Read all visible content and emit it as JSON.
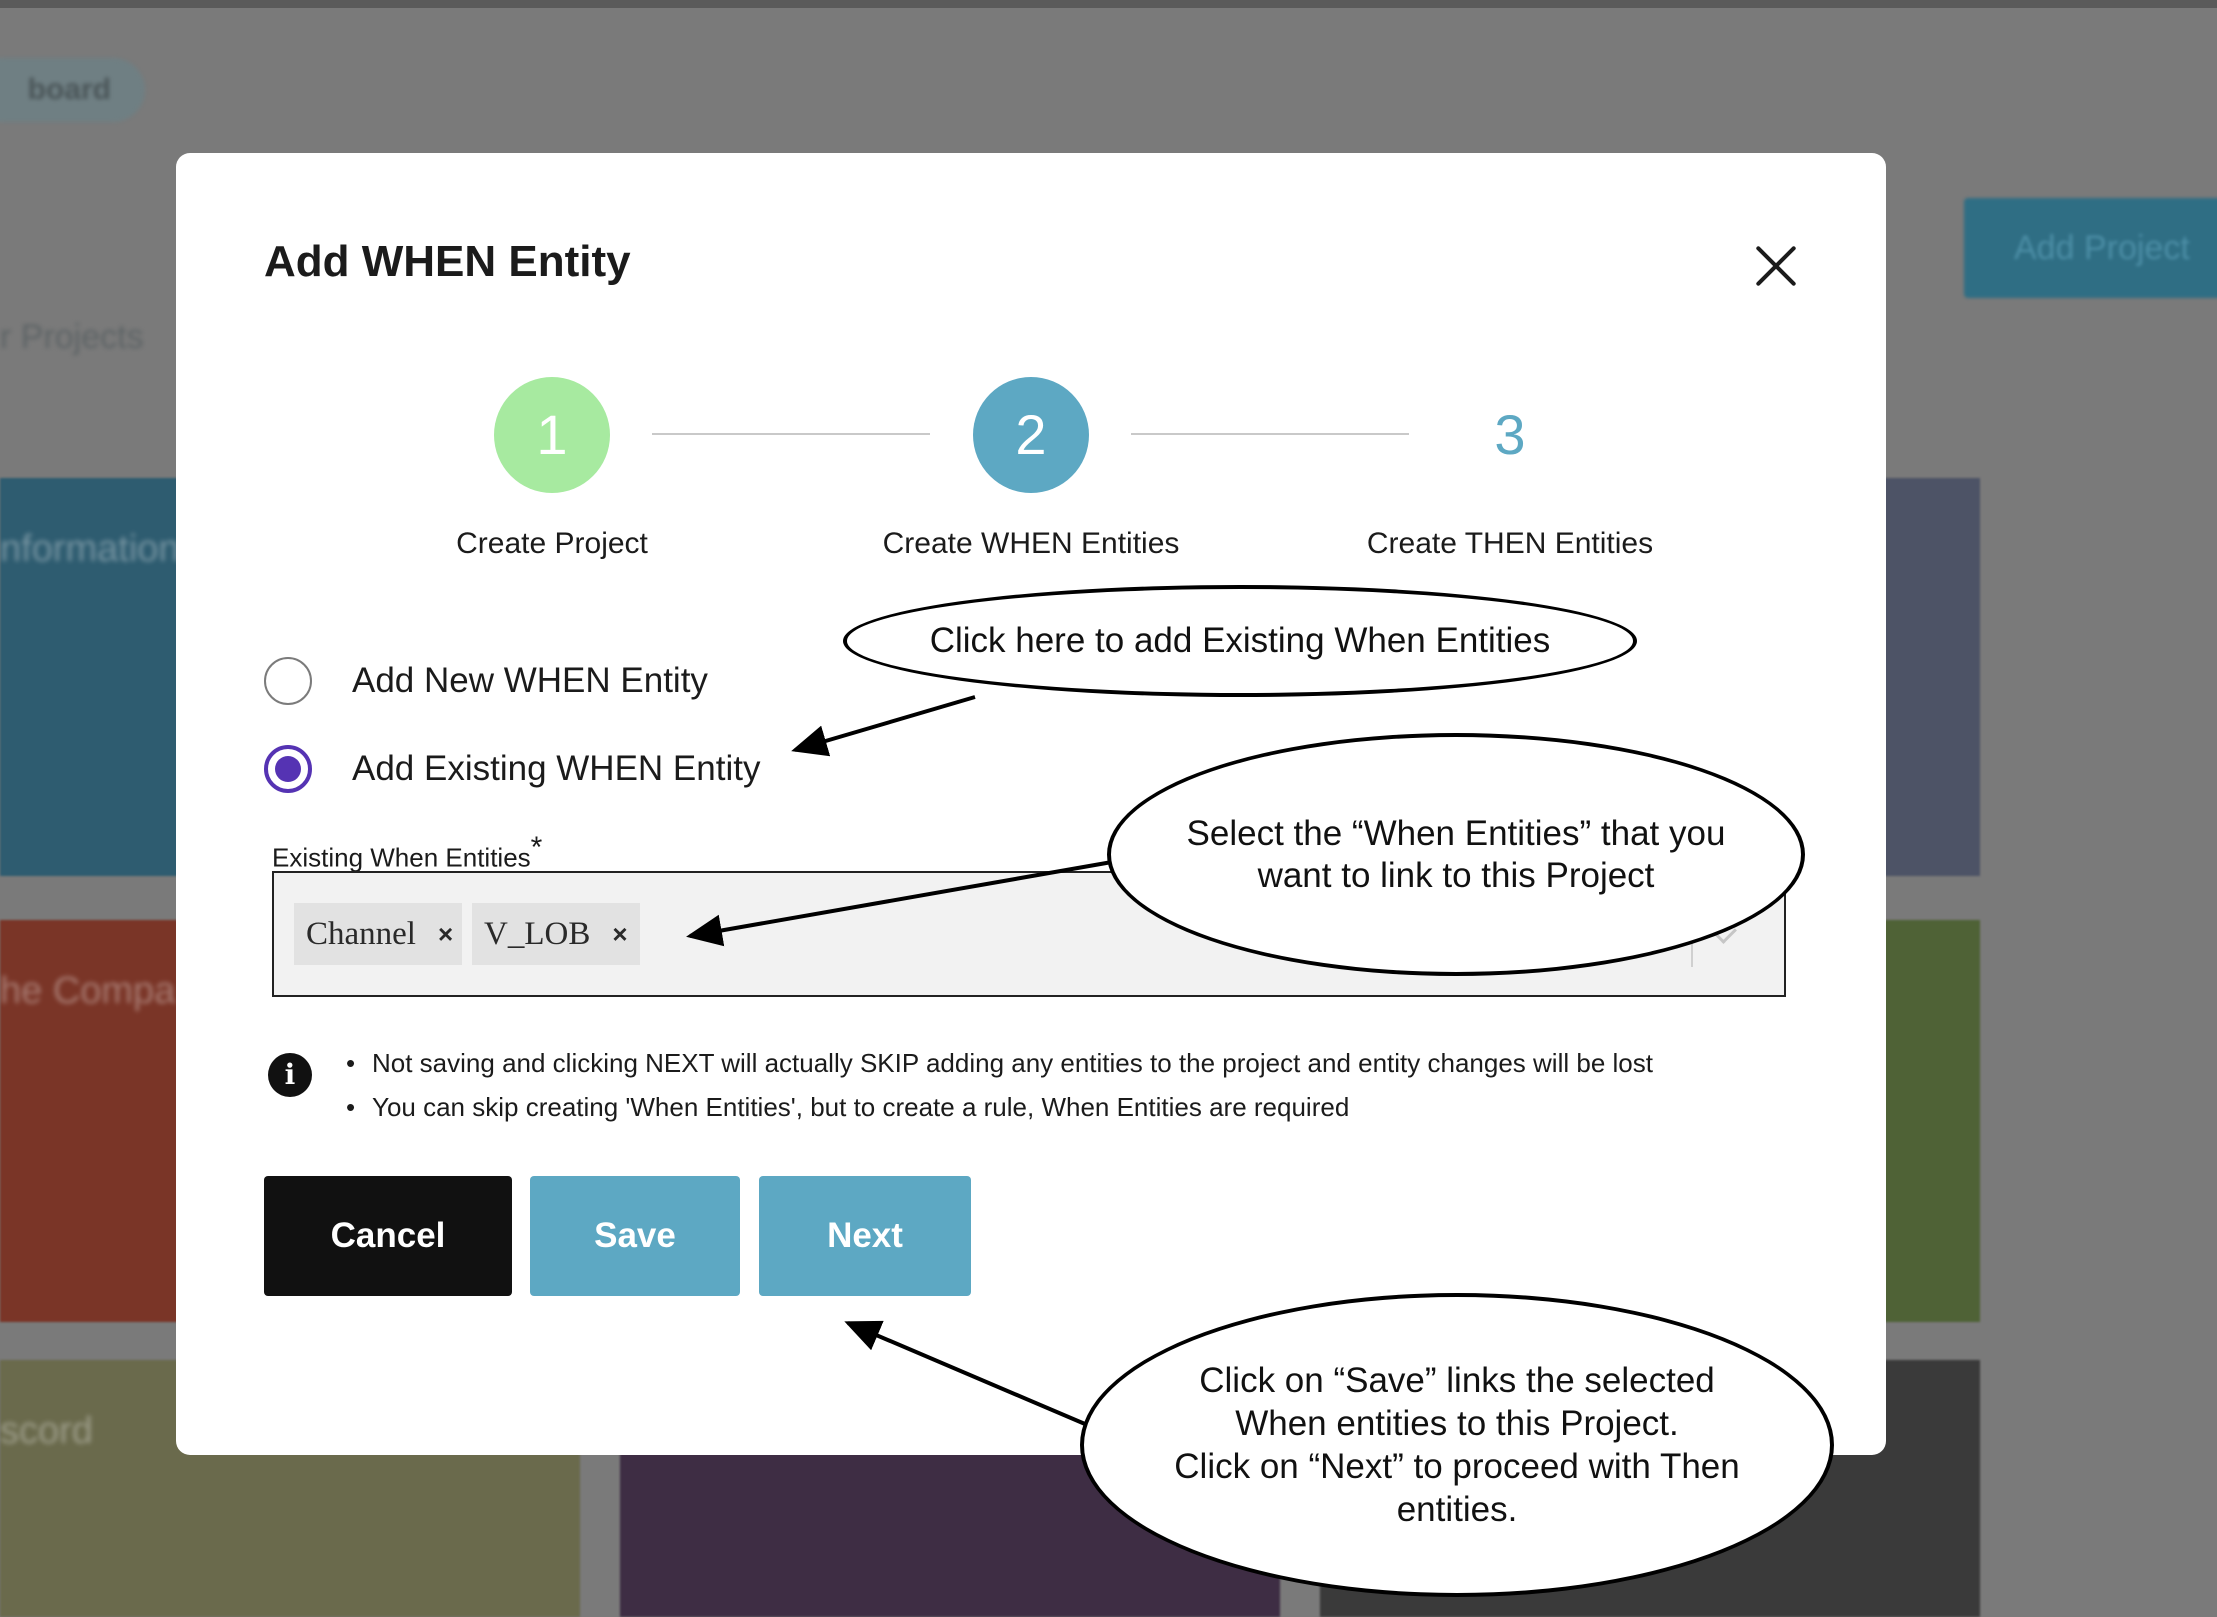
{
  "background": {
    "breadcrumb_fragment": "board",
    "heading_fragment": "r Projects",
    "add_button_fragment": "Add Project",
    "tile_labels": [
      "nformation",
      "he Compa",
      "scord"
    ]
  },
  "modal": {
    "title": "Add WHEN Entity",
    "close_icon": "close-icon",
    "steps": [
      {
        "number": "1",
        "label": "Create Project",
        "color": "#a7eaa0"
      },
      {
        "number": "2",
        "label": "Create WHEN Entities",
        "color": "#5da8c3"
      },
      {
        "number": "3",
        "label": "Create THEN Entities",
        "color": "#5da8c3"
      }
    ],
    "radio_options": [
      {
        "label": "Add New WHEN Entity",
        "checked": false
      },
      {
        "label": "Add Existing WHEN Entity",
        "checked": true
      }
    ],
    "existing_field": {
      "label": "Existing When Entities",
      "required_mark": "*",
      "chips": [
        "Channel",
        "V_LOB"
      ],
      "remove_glyph": "×"
    },
    "notes": [
      "Not saving and clicking NEXT will actually SKIP adding any entities to the project and entity changes will be lost",
      "You can skip creating 'When Entities', but to create a rule, When Entities are required"
    ],
    "info_icon_glyph": "i",
    "buttons": {
      "cancel": "Cancel",
      "save": "Save",
      "next": "Next"
    },
    "accent_color": "#5533b3",
    "primary_color": "#5da8c3"
  },
  "annotations": [
    {
      "text": "Click here to add Existing When Entities"
    },
    {
      "text": "Select the “When Entities” that you\nwant to link to this Project"
    },
    {
      "text": "Click on “Save” links the selected\nWhen entities to this Project.\nClick on “Next” to proceed with Then\nentities."
    }
  ]
}
